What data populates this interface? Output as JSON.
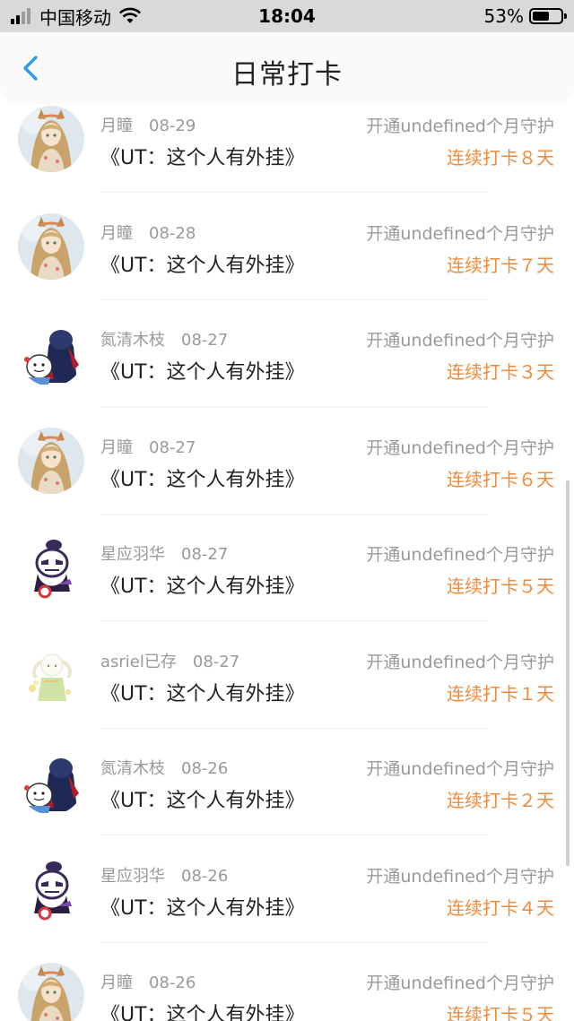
{
  "status_bar": {
    "carrier": "中国移动",
    "time": "18:04",
    "battery_percent": "53%"
  },
  "nav": {
    "title": "日常打卡"
  },
  "entries": [
    {
      "name": "月瞳",
      "date": "08-29",
      "guard": "开通undefined个月守护",
      "title": "《UT：这个人有外挂》",
      "streak": "连续打卡８天",
      "avatar": "fox-girl"
    },
    {
      "name": "月瞳",
      "date": "08-28",
      "guard": "开通undefined个月守护",
      "title": "《UT：这个人有外挂》",
      "streak": "连续打卡７天",
      "avatar": "fox-girl"
    },
    {
      "name": "氮清木枝",
      "date": "08-27",
      "guard": "开通undefined个月守护",
      "title": "《UT：这个人有外挂》",
      "streak": "连续打卡３天",
      "avatar": "hooded-duo"
    },
    {
      "name": "月瞳",
      "date": "08-27",
      "guard": "开通undefined个月守护",
      "title": "《UT：这个人有外挂》",
      "streak": "连续打卡６天",
      "avatar": "fox-girl"
    },
    {
      "name": "星应羽华",
      "date": "08-27",
      "guard": "开通undefined个月守护",
      "title": "《UT：这个人有外挂》",
      "streak": "连续打卡５天",
      "avatar": "skeleton"
    },
    {
      "name": "asriel已存",
      "date": "08-27",
      "guard": "开通undefined个月守护",
      "title": "《UT：这个人有外挂》",
      "streak": "连续打卡１天",
      "avatar": "goat-kid"
    },
    {
      "name": "氮清木枝",
      "date": "08-26",
      "guard": "开通undefined个月守护",
      "title": "《UT：这个人有外挂》",
      "streak": "连续打卡２天",
      "avatar": "hooded-duo"
    },
    {
      "name": "星应羽华",
      "date": "08-26",
      "guard": "开通undefined个月守护",
      "title": "《UT：这个人有外挂》",
      "streak": "连续打卡４天",
      "avatar": "skeleton"
    },
    {
      "name": "月瞳",
      "date": "08-26",
      "guard": "开通undefined个月守护",
      "title": "《UT：这个人有外挂》",
      "streak": "连续打卡５天",
      "avatar": "fox-girl"
    }
  ],
  "colors": {
    "streak": "#f08a3c",
    "back_arrow": "#2f9bf0",
    "muted_text": "#999999"
  }
}
